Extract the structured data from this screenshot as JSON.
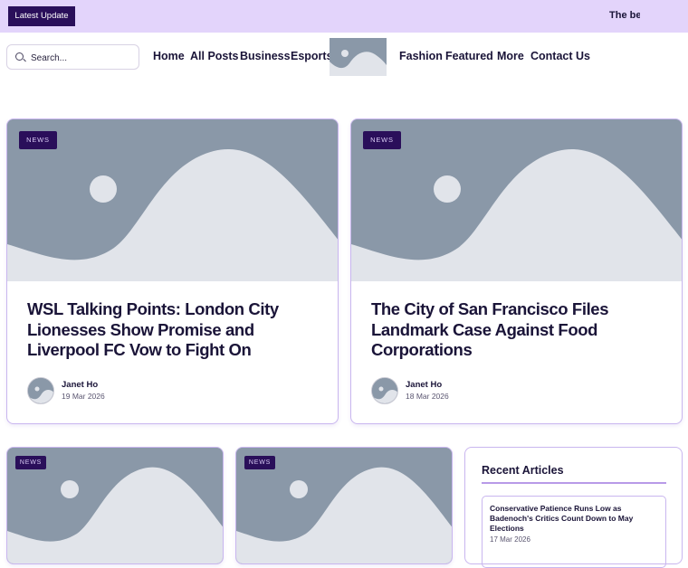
{
  "ticker": {
    "button_label": "Latest Update",
    "text": "The best"
  },
  "search": {
    "placeholder": "Search..."
  },
  "nav": {
    "items": [
      "Home",
      "All Posts",
      "Business",
      "Esports",
      "Fashion",
      "Featured",
      "More",
      "Contact Us"
    ]
  },
  "posts": [
    {
      "tag": "NEWS",
      "title": "WSL Talking Points: London City Lionesses Show Promise and Liverpool FC Vow to Fight On",
      "author": "Janet Ho",
      "date": "19 Mar 2026"
    },
    {
      "tag": "NEWS",
      "title": "The City of San Francisco Files Landmark Case Against Food Corporations",
      "author": "Janet Ho",
      "date": "18 Mar 2026"
    },
    {
      "tag": "NEWS"
    },
    {
      "tag": "NEWS"
    }
  ],
  "sidebar": {
    "title": "Recent Articles",
    "articles": [
      {
        "title": "Conservative Patience Runs Low as Badenoch's Critics Count Down to May Elections",
        "date": "17 Mar 2026"
      }
    ]
  },
  "colors": {
    "accent": "#2a0f5a",
    "ticker_bg": "#e3d4fb",
    "border": "#c9b6ef",
    "placeholder_img": "#8a98a8"
  }
}
